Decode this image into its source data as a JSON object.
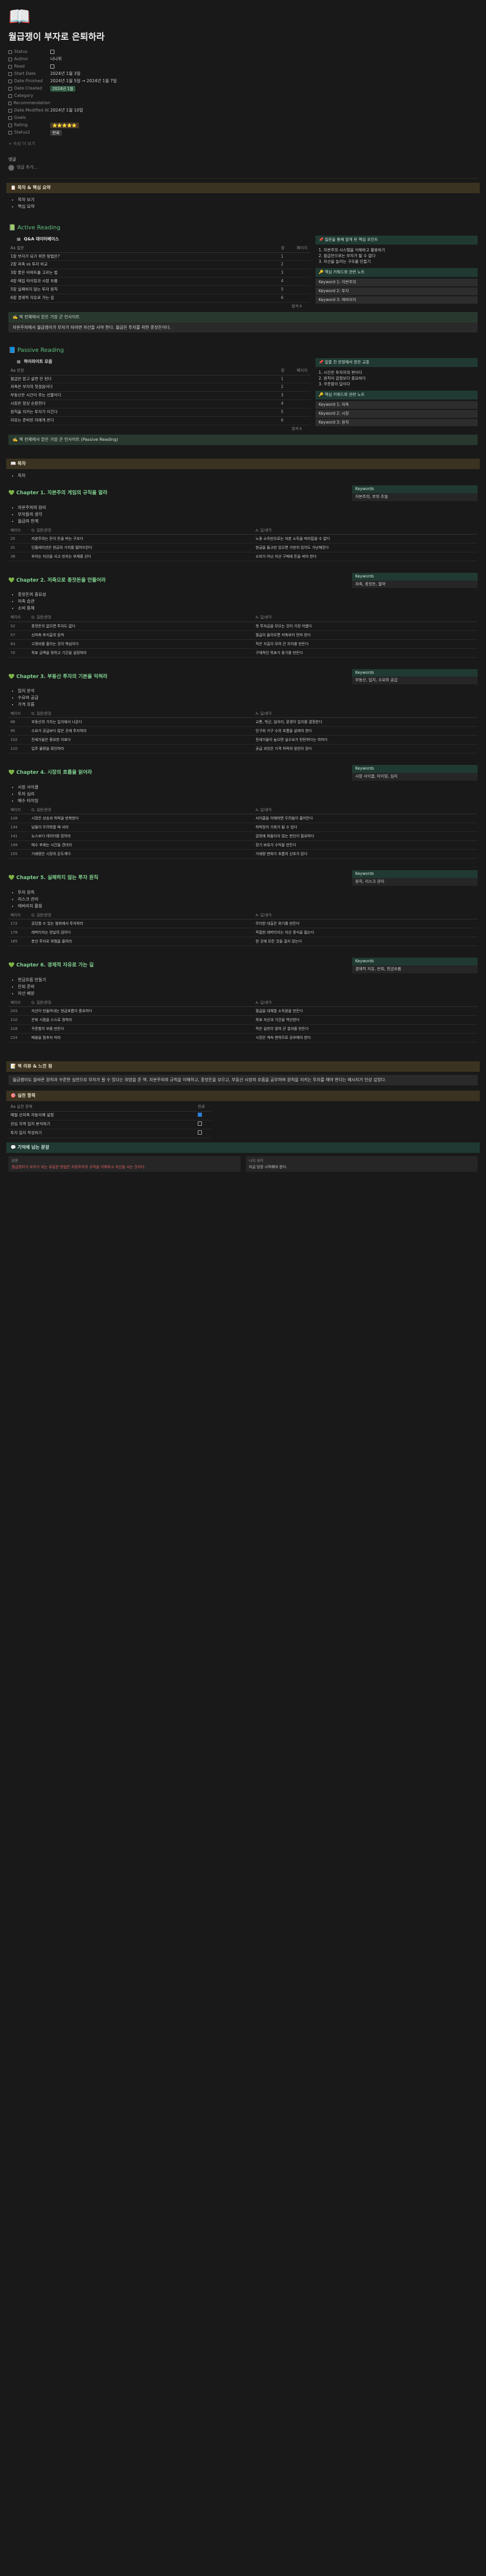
{
  "page": {
    "icon": "open-book-icon",
    "title": "월급쟁이 부자로 은퇴하라"
  },
  "props": [
    {
      "key": "Status",
      "value": "",
      "type": "checkbox"
    },
    {
      "key": "Author",
      "value": "너나위",
      "type": "text"
    },
    {
      "key": "Read",
      "value": "",
      "type": "checkbox"
    },
    {
      "key": "Start Date",
      "value": "2024년 1월 3일",
      "type": "text"
    },
    {
      "key": "Date Finished",
      "value": "2024년 1월 5일 → 2024년 1월 7일",
      "type": "text"
    },
    {
      "key": "Date Created",
      "value": "2024년 1월",
      "type": "chip-green"
    },
    {
      "key": "Category",
      "value": "",
      "type": "text"
    },
    {
      "key": "Recommendation",
      "value": "",
      "type": "text"
    },
    {
      "key": "Date Modified At",
      "value": "2024년 1월 10일",
      "type": "text"
    },
    {
      "key": "Goals",
      "value": "",
      "type": "text"
    },
    {
      "key": "Rating",
      "value": "⭐⭐⭐⭐⭐",
      "type": "chip-brown"
    },
    {
      "key": "Status2",
      "value": "완료",
      "type": "chip-gray"
    }
  ],
  "props_more": "+ 속성 더 보기",
  "comments": {
    "title": "댓글",
    "placeholder": "댓글 추가..."
  },
  "sections": {
    "toc_head": "📋 목차 & 핵심 요약",
    "toc_items": [
      "목차 보기",
      "핵심 요약"
    ],
    "active_head": "📗 Active Reading",
    "active_db_title": "Q&A 데이터베이스",
    "active_table_headers": [
      "Aa 질문",
      "장",
      "페이지"
    ],
    "active_rows": [
      {
        "q": "1장 부자가 되기 위한 방법은?",
        "ch": "1",
        "p": ""
      },
      {
        "q": "2장 저축 vs 투자 비교",
        "ch": "2",
        "p": ""
      },
      {
        "q": "3장 좋은 아파트를 고르는 법",
        "ch": "3",
        "p": ""
      },
      {
        "q": "4장 매입 타이밍과 시장 흐름",
        "ch": "4",
        "p": ""
      },
      {
        "q": "5장 실패하지 않는 투자 원칙",
        "ch": "5",
        "p": ""
      },
      {
        "q": "6장 경제적 자유로 가는 길",
        "ch": "6",
        "p": ""
      }
    ],
    "active_sum": "합계 6",
    "active_right_head": "📌 질문을 통해 알게 된 핵심 포인트",
    "active_right_lines": [
      "1. 자본주의 시스템을 이해하고 활용하기",
      "2. 월급만으로는 부자가 될 수 없다",
      "3. 자산을 늘리는 구조를 만들기"
    ],
    "active_right_kw_head": "🔑 핵심 키워드와 관련 노트",
    "active_right_kw": [
      "Keyword 1: 자본주의",
      "Keyword 2: 투자",
      "Keyword 3: 레버리지"
    ],
    "active_note": "✍️ 책 전체에서 얻은 가장 큰 인사이트",
    "active_note_body": "자본주의에서 월급쟁이가 부자가 되려면 자산을 사야 한다. 월급은 투자를 위한 종잣돈이다.",
    "passive_head": "📘 Passive Reading",
    "passive_db_title": "하이라이트 모음",
    "passive_table_headers": [
      "Aa 문장",
      "장",
      "페이지"
    ],
    "passive_rows": [
      {
        "q": "월급만 믿고 살면 안 된다",
        "ch": "1",
        "p": ""
      },
      {
        "q": "저축은 부자의 첫걸음이다",
        "ch": "2",
        "p": ""
      },
      {
        "q": "부동산은 시간이 주는 선물이다",
        "ch": "3",
        "p": ""
      },
      {
        "q": "시장은 항상 순환한다",
        "ch": "4",
        "p": ""
      },
      {
        "q": "원칙을 지키는 투자가 이긴다",
        "ch": "5",
        "p": ""
      },
      {
        "q": "자유는 준비된 자에게 온다",
        "ch": "6",
        "p": ""
      }
    ],
    "passive_sum": "합계 6",
    "passive_right_head": "📌 밑줄 친 문장에서 얻은 교훈",
    "passive_right_lines": [
      "1. 시간은 투자자의 편이다",
      "2. 원칙이 감정보다 중요하다",
      "3. 꾸준함이 답이다"
    ],
    "passive_right_kw_head": "🔑 핵심 키워드와 관련 노트",
    "passive_right_kw": [
      "Keyword 1: 저축",
      "Keyword 2: 시장",
      "Keyword 3: 원칙"
    ],
    "passive_note": "✍️ 책 전체에서 얻은 가장 큰 인사이트 (Passive Reading)",
    "detail_head": "📖 목차",
    "detail_items": [
      "목차"
    ]
  },
  "chapters": [
    {
      "title": "💚 Chapter 1. 자본주의 게임의 규칙을 알라",
      "kw_label": "Keywords",
      "kw": "자본주의, 부의 추월",
      "bullets": [
        "자본주의의 원리",
        "부자들의 생각",
        "월급의 한계"
      ],
      "rows": [
        {
          "n": "25",
          "q": "자본주의는 돈이 돈을 버는 구조다",
          "a": "노동 소득만으로는 자본 소득을 따라잡을 수 없다"
        },
        {
          "n": "31",
          "q": "인플레이션은 현금의 가치를 떨어뜨린다",
          "a": "현금을 들고만 있으면 가만히 있어도 가난해진다"
        },
        {
          "n": "38",
          "q": "부자는 자산을 사고 빈자는 부채를 산다",
          "a": "소비가 아닌 자산 구매에 돈을 써야 한다"
        }
      ]
    },
    {
      "title": "💚 Chapter 2. 저축으로 종잣돈을 만들어라",
      "kw_label": "Keywords",
      "kw": "저축, 종잣돈, 절약",
      "bullets": [
        "종잣돈의 중요성",
        "저축 습관",
        "소비 통제"
      ],
      "rows": [
        {
          "n": "52",
          "q": "종잣돈이 없으면 투자도 없다",
          "a": "첫 투자금을 모으는 것이 가장 어렵다"
        },
        {
          "n": "57",
          "q": "선저축 후지출의 원칙",
          "a": "월급이 들어오면 저축부터 먼저 한다"
        },
        {
          "n": "63",
          "q": "고정비를 줄이는 것이 핵심이다",
          "a": "작은 지출이 모여 큰 차이를 만든다"
        },
        {
          "n": "70",
          "q": "목표 금액을 정하고 기간을 설정하라",
          "a": "구체적인 목표가 동기를 만든다"
        }
      ]
    },
    {
      "title": "💚 Chapter 3. 부동산 투자의 기본을 익혀라",
      "kw_label": "Keywords",
      "kw": "부동산, 입지, 수요와 공급",
      "bullets": [
        "입지 분석",
        "수요와 공급",
        "가격 흐름"
      ],
      "rows": [
        {
          "n": "88",
          "q": "부동산의 가치는 입지에서 나온다",
          "a": "교통, 학군, 일자리, 환경이 입지를 결정한다"
        },
        {
          "n": "95",
          "q": "수요가 공급보다 많은 곳에 투자하라",
          "a": "인구와 가구 수의 흐름을 살펴야 한다"
        },
        {
          "n": "102",
          "q": "전세가율은 중요한 지표다",
          "a": "전세가율이 높으면 실수요가 탄탄하다는 의미다"
        },
        {
          "n": "110",
          "q": "입주 물량을 확인하라",
          "a": "공급 과잉은 가격 하락의 원인이 된다"
        }
      ]
    },
    {
      "title": "💚 Chapter 4. 시장의 흐름을 읽어라",
      "kw_label": "Keywords",
      "kw": "시장 사이클, 타이밍, 심리",
      "bullets": [
        "시장 사이클",
        "투자 심리",
        "매수 타이밍"
      ],
      "rows": [
        {
          "n": "128",
          "q": "시장은 상승과 하락을 반복한다",
          "a": "사이클을 이해하면 두려움이 줄어든다"
        },
        {
          "n": "134",
          "q": "남들이 두려워할 때 사라",
          "a": "하락장이 기회가 될 수 있다"
        },
        {
          "n": "141",
          "q": "뉴스보다 데이터를 믿어라",
          "a": "감정에 휘둘리지 않는 판단이 필요하다"
        },
        {
          "n": "149",
          "q": "매수 후에는 시간을 견뎌라",
          "a": "장기 보유가 수익을 만든다"
        },
        {
          "n": "155",
          "q": "거래량은 시장의 온도계다",
          "a": "거래량 변화가 흐름의 신호가 된다"
        }
      ]
    },
    {
      "title": "💚 Chapter 5. 실패하지 않는 투자 원칙",
      "kw_label": "Keywords",
      "kw": "원칙, 리스크 관리",
      "bullets": [
        "투자 원칙",
        "리스크 관리",
        "레버리지 활용"
      ],
      "rows": [
        {
          "n": "172",
          "q": "감당할 수 있는 범위에서 투자하라",
          "a": "무리한 대출은 위기를 만든다"
        },
        {
          "n": "178",
          "q": "레버리지는 양날의 검이다",
          "a": "적절한 레버리지는 자산 증식을 돕는다"
        },
        {
          "n": "185",
          "q": "분산 투자로 위험을 줄여라",
          "a": "한 곳에 모든 것을 걸지 않는다"
        }
      ]
    },
    {
      "title": "💚 Chapter 6. 경제적 자유로 가는 길",
      "kw_label": "Keywords",
      "kw": "경제적 자유, 은퇴, 현금흐름",
      "bullets": [
        "현금흐름 만들기",
        "은퇴 준비",
        "자산 배분"
      ],
      "rows": [
        {
          "n": "203",
          "q": "자산이 만들어내는 현금흐름이 중요하다",
          "a": "월급을 대체할 소득원을 만든다"
        },
        {
          "n": "210",
          "q": "은퇴 시점을 스스로 정하라",
          "a": "목표 자산과 기간을 역산한다"
        },
        {
          "n": "218",
          "q": "꾸준함이 부를 만든다",
          "a": "작은 실천이 쌓여 큰 결과를 만든다"
        },
        {
          "n": "224",
          "q": "배움을 멈추지 마라",
          "a": "시장은 계속 변하므로 공부해야 한다"
        }
      ]
    }
  ],
  "qa_headers": [
    "페이지",
    "Q. 질문/문장",
    "A. 답/생각"
  ],
  "final": {
    "review_head": "📝 책 리뷰 & 느낀 점",
    "review_body": "월급쟁이도 올바른 원칙과 꾸준한 실천으로 부자가 될 수 있다는 희망을 준 책. 자본주의의 규칙을 이해하고, 종잣돈을 모으고, 부동산 시장의 흐름을 공부하며 원칙을 지키는 투자를 해야 한다는 메시지가 인상 깊었다.",
    "action_head": "🎯 실천 항목",
    "action_headers": [
      "Aa 실천 항목",
      "완료"
    ],
    "actions": [
      {
        "t": "매월 선저축 자동이체 설정",
        "done": "true"
      },
      {
        "t": "관심 지역 입지 분석하기",
        "done": "false"
      },
      {
        "t": "투자 일지 작성하기",
        "done": "false"
      }
    ],
    "quote_head": "💬 기억에 남는 문장",
    "quote_left_h": "원문",
    "quote_left": "월급쟁이가 부자가 되는 유일한 방법은 자본주의의 규칙을 이해하고 자산을 사는 것이다.",
    "quote_right_h": "나의 생각",
    "quote_right": "지금 당장 시작해야 한다."
  }
}
